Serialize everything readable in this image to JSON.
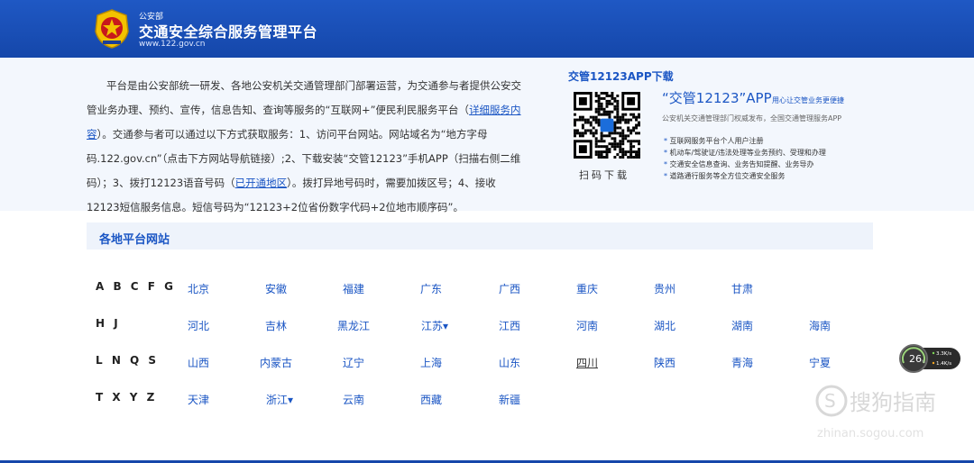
{
  "header": {
    "small": "公安部",
    "title": "交通安全综合服务管理平台",
    "url": "www.122.gov.cn"
  },
  "intro": {
    "p1": "平台是由公安部统一研发、各地公安机关交通管理部门部署运营，为交通参与者提供公安交管业务办理、预约、宣传，信息告知、查询等服务的“互联网+”便民利民服务平台（",
    "link1": "详细服务内容",
    "p2": "）。交通参与者可以通过以下方式获取服务：1、访问平台网站。网站域名为“地方字母码.122.gov.cn”（点击下方网站导航链接）;2、下载安装“交管12123”手机APP（扫描右侧二维码）；3、拨打12123语音号码（",
    "link2": "已开通地区",
    "p3": "）。拨打异地号码时，需要加拨区号；4、接收12123短信服务信息。短信号码为“12123+2位省份数字代码+2位地市顺序码”。"
  },
  "app": {
    "title": "交管12123APP下载",
    "qr_caption": "扫码下载",
    "name": "“交管12123”APP",
    "slogan": "用心让交管业务更便捷",
    "desc": "公安机关交通管理部门权威发布，全国交通管理服务APP",
    "features": [
      "互联网服务平台个人用户注册",
      "机动车/驾驶证/违法处理等业务预约、受理和办理",
      "交通安全信息查询、业务告知提醒、业务导办",
      "道路通行服务等全方位交通安全服务"
    ]
  },
  "regions": {
    "title": "各地平台网站",
    "rows": [
      {
        "letters": "A B C F G",
        "items": [
          "北京",
          "安徽",
          "福建",
          "广东",
          "广西",
          "重庆",
          "贵州",
          "甘肃"
        ]
      },
      {
        "letters": "H J",
        "items": [
          "河北",
          "吉林",
          "黑龙江",
          "江苏▾",
          "江西",
          "河南",
          "湖北",
          "湖南",
          "海南"
        ]
      },
      {
        "letters": "L N Q S",
        "items": [
          "山西",
          "内蒙古",
          "辽宁",
          "上海",
          "山东",
          "四川",
          "陕西",
          "青海",
          "宁夏"
        ]
      },
      {
        "letters": "T X Y Z",
        "items": [
          "天津",
          "浙江▾",
          "云南",
          "西藏",
          "新疆"
        ]
      }
    ]
  },
  "widget": {
    "value": "26",
    "unit": "%",
    "up": "3.3K/s",
    "down": "1.4K/s"
  },
  "watermark": {
    "text": "搜狗指南",
    "url": "zhinan.sogou.com"
  },
  "colors": {
    "header_blue": "#1d4fb8",
    "link_blue": "#1b56c4",
    "band_bg": "#f3f7fd"
  }
}
